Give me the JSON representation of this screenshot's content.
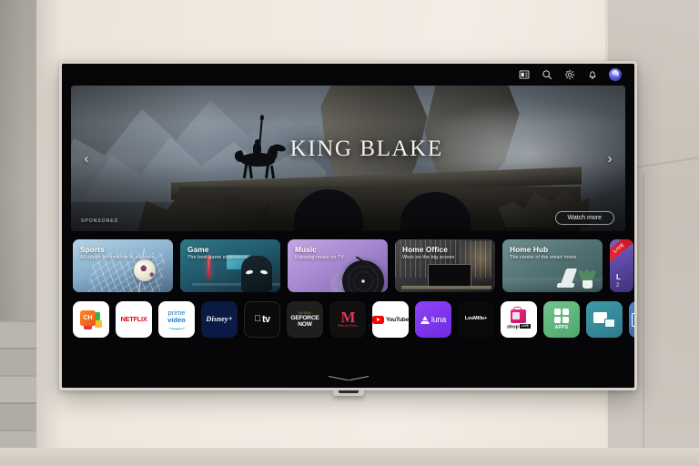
{
  "device": {
    "type": "smart-tv",
    "stand_label": ""
  },
  "topbar": {
    "icons": [
      {
        "name": "multiview-icon",
        "label": "Multi View"
      },
      {
        "name": "search-icon",
        "label": "Search"
      },
      {
        "name": "settings-gear-icon",
        "label": "Settings"
      },
      {
        "name": "notification-bell-icon",
        "label": "Notifications"
      },
      {
        "name": "profile-avatar",
        "label": "Profile"
      }
    ]
  },
  "hero": {
    "title": "KING BLAKE",
    "sponsored_label": "SPONSORED",
    "watch_more_label": "Watch more",
    "prev_arrow": "‹",
    "next_arrow": "›"
  },
  "cards": [
    {
      "title": "Sports",
      "subtitle": "All sports information at a glance",
      "accent": "#7fa9c9"
    },
    {
      "title": "Game",
      "subtitle": "The best game experience",
      "accent": "#215a6d"
    },
    {
      "title": "Music",
      "subtitle": "Enjoying music on TV",
      "accent": "#a588cf"
    },
    {
      "title": "Home Office",
      "subtitle": "Work on the big screen",
      "accent": "#343436"
    },
    {
      "title": "Home Hub",
      "subtitle": "The center of the smart home",
      "accent": "#537274"
    },
    {
      "title": "L",
      "subtitle": "2",
      "badge": "LIVE",
      "accent": "#5b46a0"
    }
  ],
  "apps": [
    {
      "name": "channels",
      "label": "CH"
    },
    {
      "name": "netflix",
      "label": "NETFLIX"
    },
    {
      "name": "prime-video",
      "label": "prime video",
      "line1": "prime",
      "line2": "video"
    },
    {
      "name": "disney-plus",
      "label": "Disney+"
    },
    {
      "name": "apple-tv",
      "label": "tv",
      "glyph": ""
    },
    {
      "name": "geforce-now",
      "label": "GEFORCE NOW",
      "brand": "NVIDIA",
      "line1": "GEFORCE",
      "line2": "NOW"
    },
    {
      "name": "masterclass",
      "label": "MasterClass",
      "mark": "M",
      "word": "MasterClass"
    },
    {
      "name": "youtube",
      "label": "YouTube"
    },
    {
      "name": "luna",
      "label": "luna"
    },
    {
      "name": "lesmills",
      "label": "LesMills+"
    },
    {
      "name": "shop-live",
      "label": "shop",
      "badge": "LIVE"
    },
    {
      "name": "apps",
      "label": "APPS"
    },
    {
      "name": "multi-view",
      "label": "Multi View"
    },
    {
      "name": "more-app",
      "label": ""
    }
  ],
  "colors": {
    "screen_bg": "#060608",
    "accent_live": "#ef2b36",
    "netflix_red": "#e50914",
    "prime_blue": "#1b7fc4",
    "nvidia_green": "#76b900",
    "luna_purple": "#8a3df0"
  },
  "footer": {
    "scroll_hint": "chevron-down"
  }
}
